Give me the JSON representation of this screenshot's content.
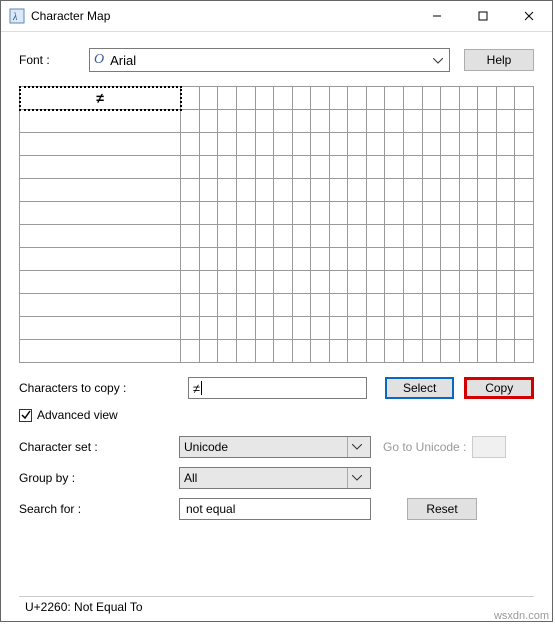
{
  "titlebar": {
    "title": "Character Map"
  },
  "font_row": {
    "label": "Font :",
    "icon_letter": "O",
    "font_name": "Arial"
  },
  "help_button_label": "Help",
  "grid": {
    "rows": 12,
    "cols": 20,
    "selected": {
      "row": 0,
      "col": 0,
      "glyph": "≠"
    }
  },
  "copy_row": {
    "label": "Characters to copy :",
    "value": "≠",
    "select_label": "Select",
    "copy_label": "Copy"
  },
  "advanced_view": {
    "checked": true,
    "label": "Advanced view"
  },
  "charset_row": {
    "label": "Character set :",
    "value": "Unicode",
    "goto_label": "Go to Unicode :",
    "goto_value": ""
  },
  "group_row": {
    "label": "Group by :",
    "value": "All"
  },
  "search_row": {
    "label": "Search for :",
    "value": "not equal",
    "reset_label": "Reset"
  },
  "status_bar": "U+2260: Not Equal To",
  "watermark": "wsxdn.com"
}
